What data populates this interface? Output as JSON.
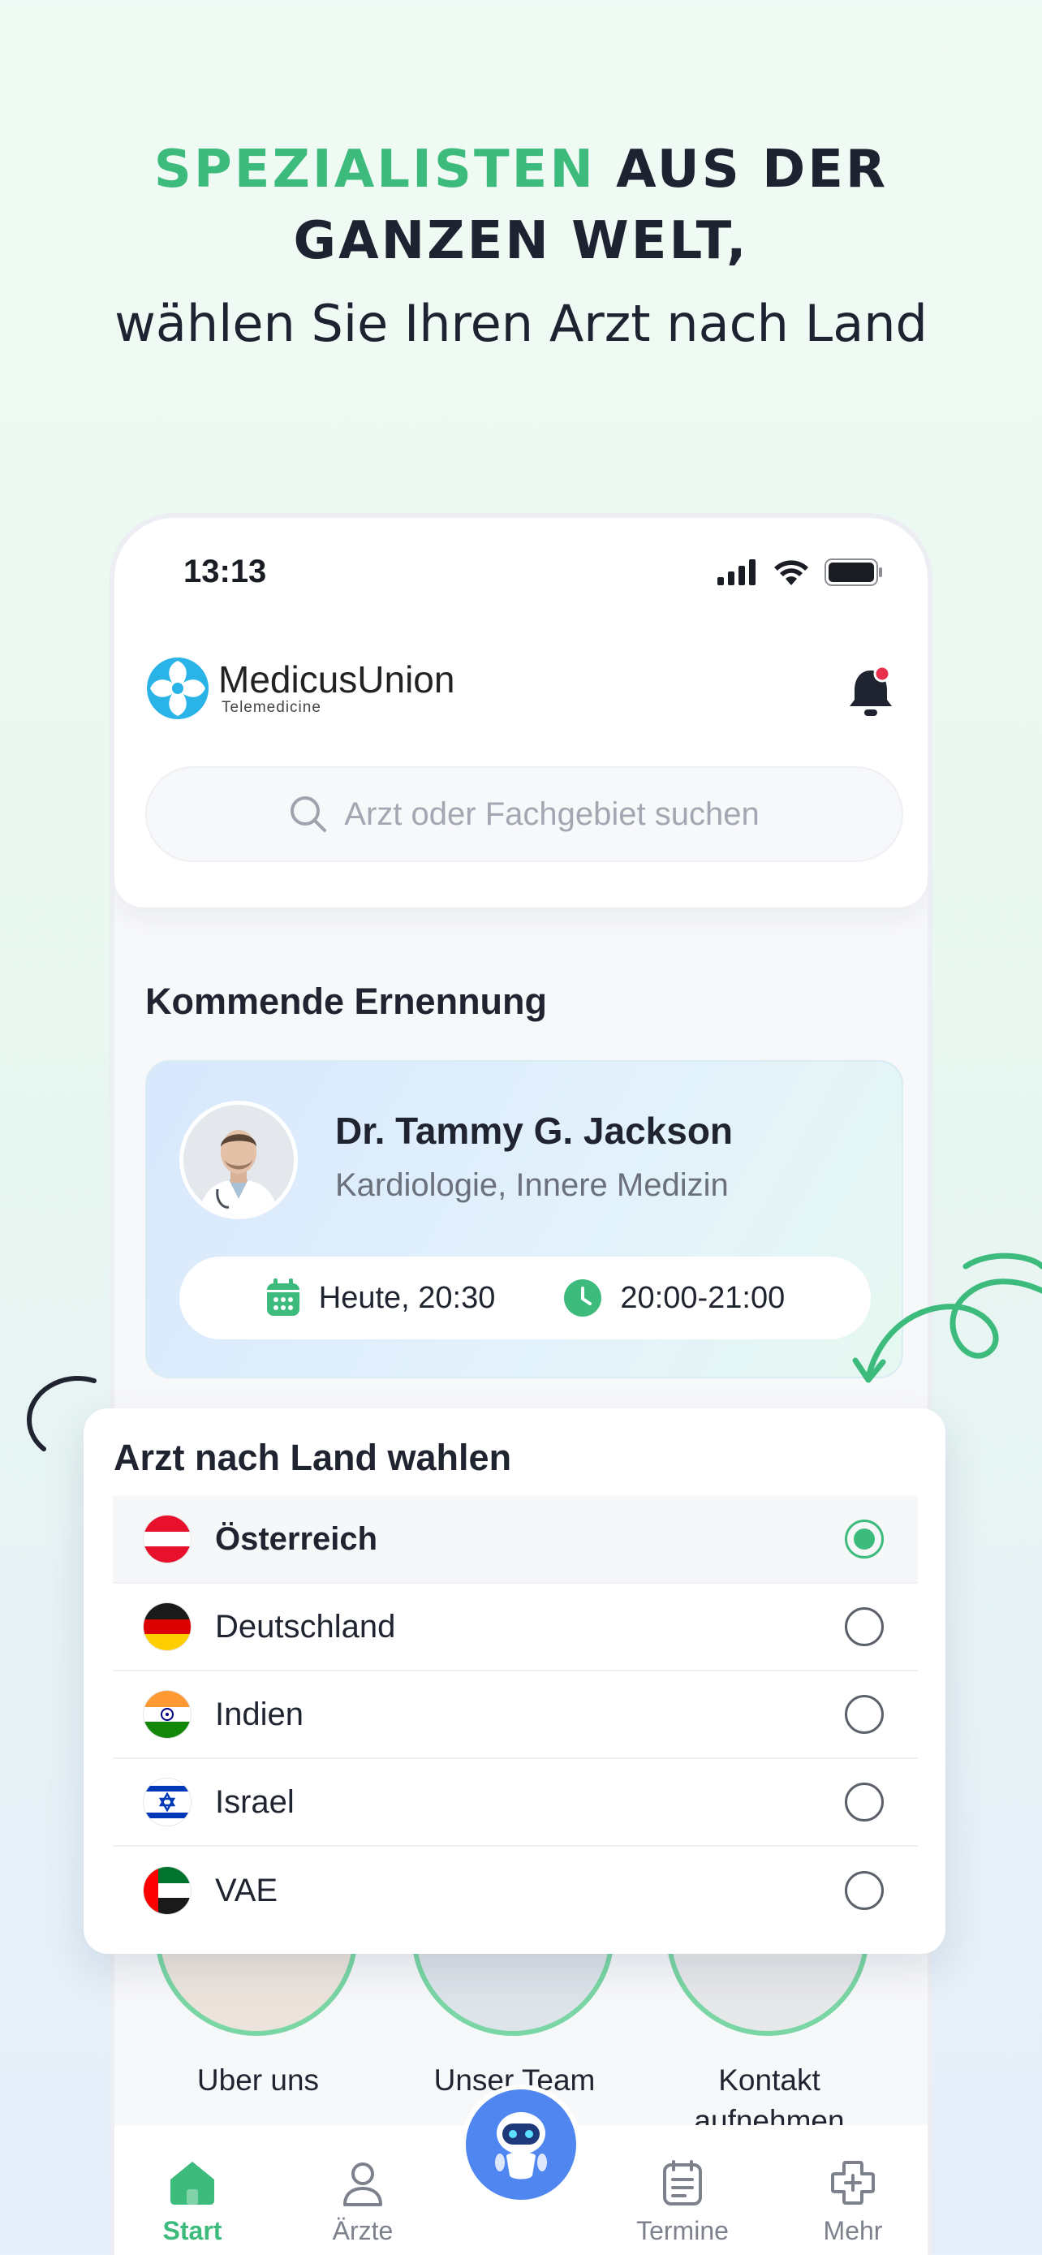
{
  "headline": {
    "highlight": "SPEZIALISTEN",
    "line1_rest": " AUS DER",
    "line2": "GANZEN WELT,",
    "line3": "wählen Sie Ihren Arzt nach Land"
  },
  "status_bar": {
    "time": "13:13"
  },
  "brand": {
    "name": "MedicusUnion",
    "tagline": "Telemedicine"
  },
  "search": {
    "placeholder": "Arzt oder Fachgebiet suchen"
  },
  "appointment": {
    "section_title": "Kommende Ernennung",
    "doctor_name": "Dr. Tammy G. Jackson",
    "specialty": "Kardiologie, Innere Medizin",
    "date": "Heute, 20:30",
    "time_range": "20:00-21:00"
  },
  "country_picker": {
    "title": "Arzt nach Land wahlen",
    "countries": [
      {
        "name": "Österreich",
        "flag": "austria-flag",
        "selected": true
      },
      {
        "name": "Deutschland",
        "flag": "germany-flag",
        "selected": false
      },
      {
        "name": "Indien",
        "flag": "india-flag",
        "selected": false
      },
      {
        "name": "Israel",
        "flag": "israel-flag",
        "selected": false
      },
      {
        "name": "VAE",
        "flag": "uae-flag",
        "selected": false
      }
    ]
  },
  "quick_links": {
    "about": "Uber uns",
    "team": "Unser Team",
    "contact_line1": "Kontakt",
    "contact_line2": "aufnehmen"
  },
  "tabbar": {
    "start": "Start",
    "doctors": "Ärzte",
    "appointments": "Termine",
    "more": "Mehr",
    "active": "start"
  },
  "colors": {
    "accent_green": "#3dbb7c",
    "bot_blue": "#4f86f0",
    "text_dark": "#1d2330"
  }
}
